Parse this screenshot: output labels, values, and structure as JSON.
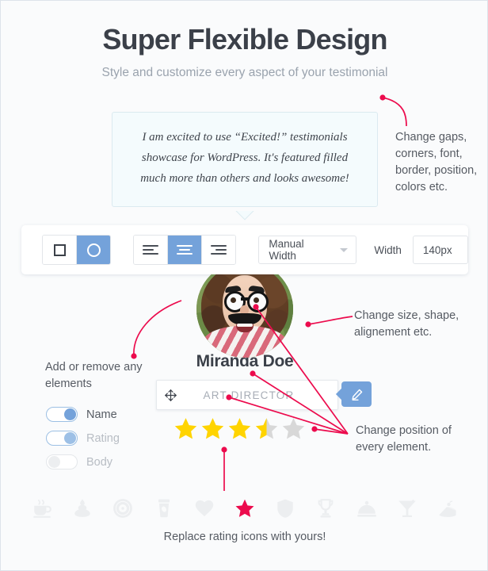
{
  "header": {
    "title": "Super Flexible Design",
    "subtitle": "Style and customize every aspect of your testimonial"
  },
  "quote": {
    "text": "I am excited to use “Excited!” testimonials showcase for WordPress. It's featured filled much more than others and looks awesome!"
  },
  "toolbar": {
    "shape_buttons": [
      {
        "name": "square-shape",
        "glyph": "square",
        "active": false
      },
      {
        "name": "circle-shape",
        "glyph": "circle",
        "active": true
      }
    ],
    "align_buttons": [
      {
        "name": "align-left",
        "glyph": "align-left",
        "active": false
      },
      {
        "name": "align-center",
        "glyph": "align-center",
        "active": true
      },
      {
        "name": "align-right",
        "glyph": "align-right",
        "active": false
      }
    ],
    "width_mode": "Manual Width",
    "width_label": "Width",
    "width_value": "140px"
  },
  "person": {
    "name": "Miranda Doe",
    "role": "ART DIRECTOR"
  },
  "elements_panel": {
    "heading": "Add or remove any elements",
    "toggles": [
      {
        "label": "Name",
        "state": "on"
      },
      {
        "label": "Rating",
        "state": "on"
      },
      {
        "label": "Body",
        "state": "off"
      }
    ]
  },
  "rating": {
    "value": 3.5,
    "max": 5,
    "filled_color": "#ffd400",
    "empty_color": "#d8d8d8"
  },
  "annotations": [
    {
      "name": "annotation-style",
      "text": "Change gaps, corners, font, border, position, colors etc."
    },
    {
      "name": "annotation-avatar",
      "text": "Change size, shape, alignement etc."
    },
    {
      "name": "annotation-position",
      "text": "Change position of every element."
    }
  ],
  "icon_strip": {
    "caption": "Replace rating icons with yours!",
    "active_index": 5,
    "active_color": "#ec0b4d",
    "inactive_color": "#eceef0",
    "icons": [
      "coffee-cup-icon",
      "ice-cream-icon",
      "vinyl-record-icon",
      "togo-cup-icon",
      "heart-icon",
      "star-icon",
      "shield-icon",
      "trophy-icon",
      "cloche-icon",
      "cocktail-icon",
      "cake-slice-icon"
    ]
  },
  "colors": {
    "accent_blue": "#74a2da",
    "accent_crimson": "#ec0b4d",
    "page_bg": "#fafbfc",
    "quote_bg": "#f4fbfd"
  }
}
